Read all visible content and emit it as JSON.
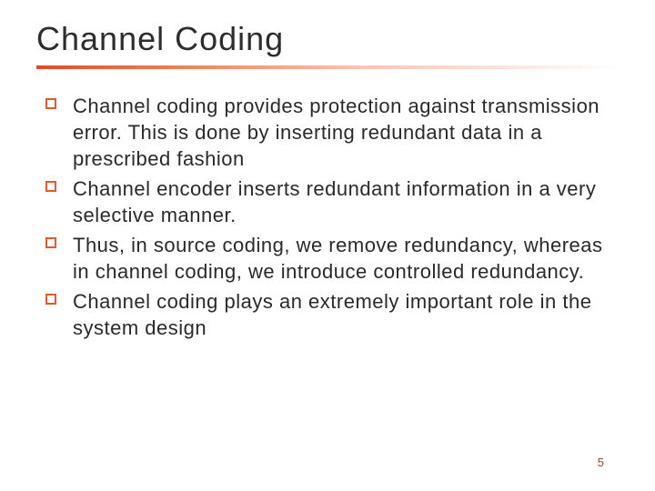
{
  "title": "Channel Coding",
  "bullets": [
    "Channel coding provides protection against transmission error. This is done by inserting redundant data in a prescribed fashion",
    "Channel encoder inserts redundant information in a very selective manner.",
    "Thus, in source coding, we remove redundancy, whereas in channel coding, we introduce controlled redundancy.",
    "Channel coding plays an extremely important role in the system design"
  ],
  "page_number": "5"
}
